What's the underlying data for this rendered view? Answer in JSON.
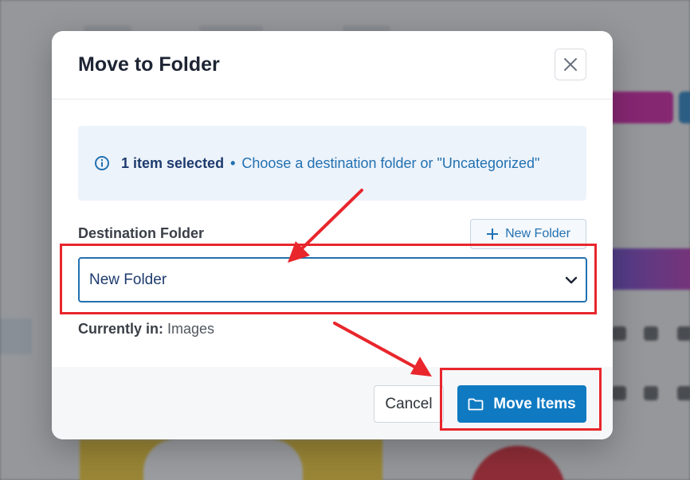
{
  "modal": {
    "title": "Move to Folder",
    "info": {
      "count_text": "1 item selected",
      "separator": "•",
      "message": "Choose a destination folder or \"Uncategorized\""
    },
    "destination_label": "Destination Folder",
    "new_folder_button": "New Folder",
    "selected_folder": "New Folder",
    "current_label": "Currently in:",
    "current_value": "Images",
    "cancel_button": "Cancel",
    "move_button": "Move Items"
  },
  "colors": {
    "accent": "#2271b1",
    "primary_button": "#0f7ac2",
    "annotation_red": "#e8262c"
  },
  "icons": [
    "close-icon",
    "info-icon",
    "plus-icon",
    "chevron-down-icon",
    "folder-icon",
    "annotation-arrow"
  ]
}
